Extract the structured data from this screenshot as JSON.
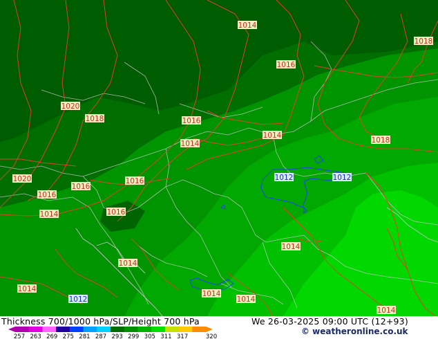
{
  "header": {
    "title": "Thickness 700/1000 hPa/SLP/Height 700 hPa",
    "datetime": "We 26-03-2025 09:00 UTC (12+93)",
    "credit": "© weatheronline.co.uk"
  },
  "colors": {
    "dark_green": "#006e00",
    "mid_green": "#009a00",
    "light_green": "#00c000",
    "bright_green": "#00dc00",
    "isobar_red": "#e0402a",
    "isobar_blue": "#2040ff",
    "border_gray": "#c8c8c8"
  },
  "legend": {
    "ticks": [
      "257",
      "263",
      "269",
      "275",
      "281",
      "287",
      "293",
      "299",
      "305",
      "311",
      "317",
      "320"
    ],
    "colors": [
      "#b000b0",
      "#e000e0",
      "#ff60ff",
      "#2000a0",
      "#0040ff",
      "#00a0ff",
      "#00d0ff",
      "#006e00",
      "#009000",
      "#00b400",
      "#00e000",
      "#c8e000",
      "#ffc800",
      "#ff8c00"
    ]
  },
  "isobar_labels": [
    {
      "text": "1014",
      "kind": "red"
    },
    {
      "text": "1018",
      "kind": "red"
    },
    {
      "text": "1016",
      "kind": "red"
    },
    {
      "text": "1020",
      "kind": "red"
    },
    {
      "text": "1018",
      "kind": "red"
    },
    {
      "text": "1016",
      "kind": "red"
    },
    {
      "text": "1014",
      "kind": "red"
    },
    {
      "text": "1014",
      "kind": "red"
    },
    {
      "text": "1018",
      "kind": "red"
    },
    {
      "text": "1012",
      "kind": "blue"
    },
    {
      "text": "1012",
      "kind": "blue"
    },
    {
      "text": "1020",
      "kind": "red"
    },
    {
      "text": "1016",
      "kind": "red"
    },
    {
      "text": "1016",
      "kind": "red"
    },
    {
      "text": "1016",
      "kind": "red"
    },
    {
      "text": "1014",
      "kind": "red"
    },
    {
      "text": "1016",
      "kind": "red"
    },
    {
      "text": "1014",
      "kind": "red"
    },
    {
      "text": "1014",
      "kind": "red"
    },
    {
      "text": "1014",
      "kind": "red"
    },
    {
      "text": "1012",
      "kind": "blue"
    },
    {
      "text": "1014",
      "kind": "red"
    },
    {
      "text": "1014",
      "kind": "red"
    },
    {
      "text": "1014",
      "kind": "red"
    }
  ]
}
